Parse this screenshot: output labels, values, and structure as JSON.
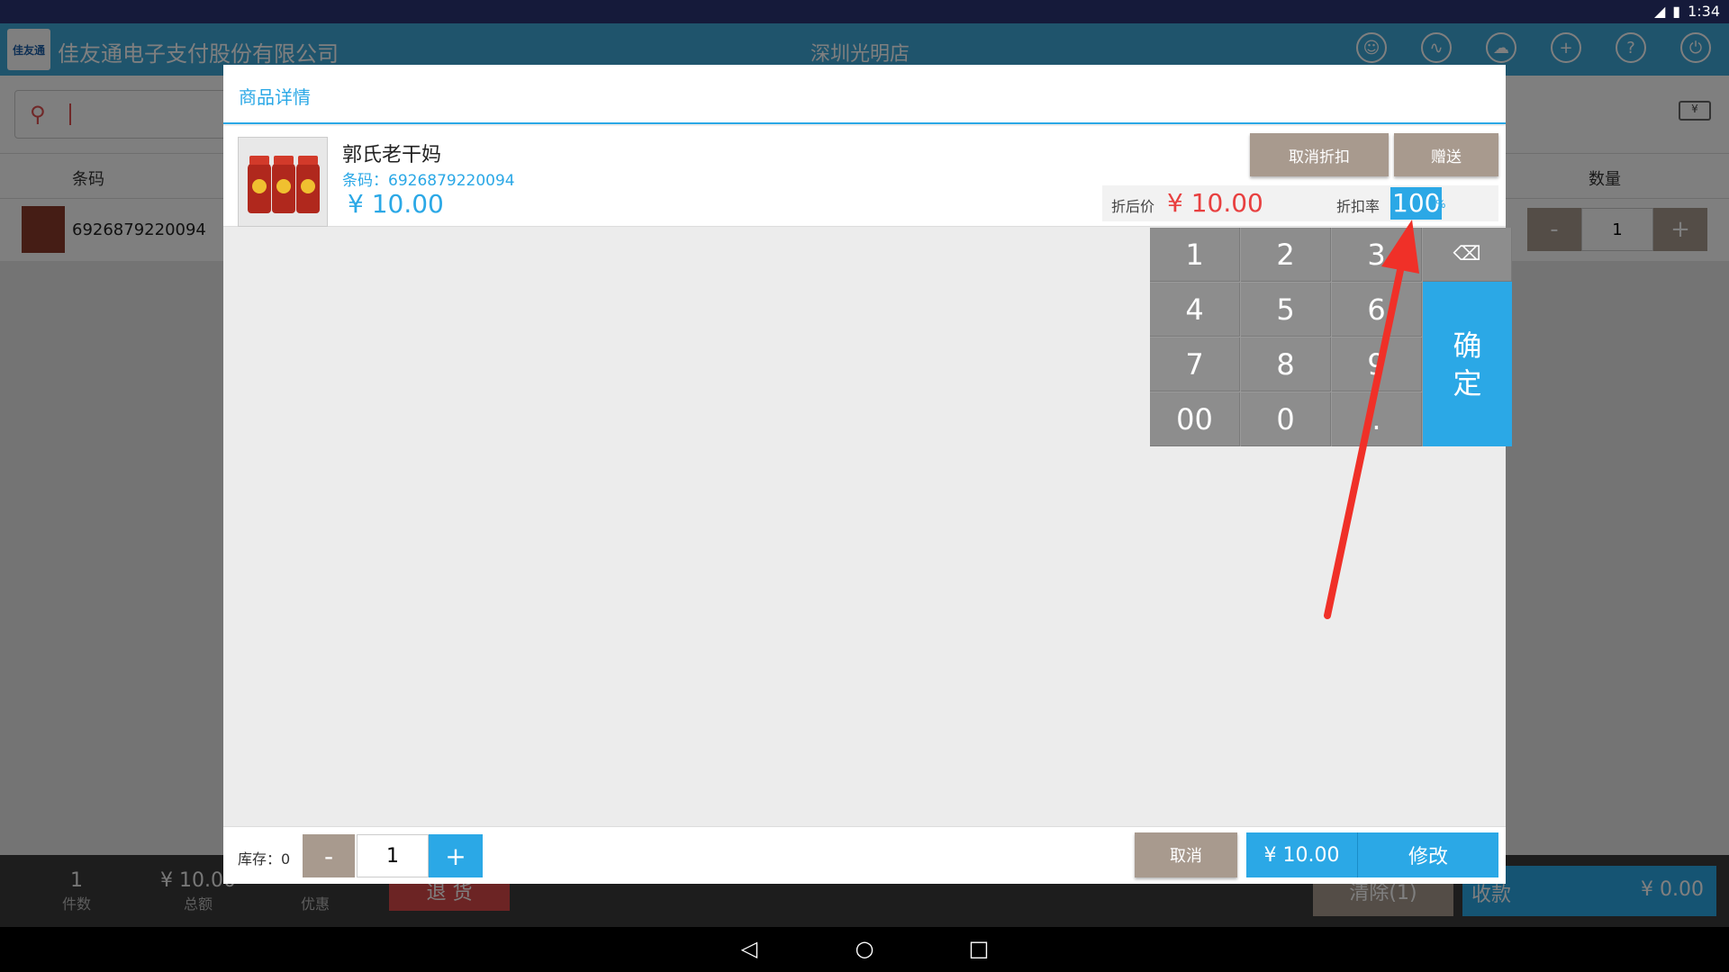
{
  "status": {
    "time": "1:34"
  },
  "app": {
    "company": "佳友通电子支付股份有限公司",
    "store": "深圳光明店",
    "logo_text": "佳友通"
  },
  "cart_table": {
    "col_barcode": "条码",
    "col_qty": "数量",
    "rows": [
      {
        "barcode": "6926879220094",
        "qty": "1"
      }
    ],
    "minus": "-",
    "plus": "+"
  },
  "bottom": {
    "count_value": "1",
    "count_label": "件数",
    "total_value": "¥ 10.00",
    "total_label": "总额",
    "discount_label": "优惠",
    "return_label": "退 货",
    "clear_label": "清除(1)",
    "pay_label": "收款",
    "pay_amount": "¥ 0.00"
  },
  "dialog": {
    "title": "商品详情",
    "product": {
      "name": "郭氏老干妈",
      "barcode": "条码：6926879220094",
      "price": "¥ 10.00"
    },
    "cancel_discount": "取消折扣",
    "gift": "赠送",
    "discounted_price_label": "折后价",
    "discounted_price": "¥ 10.00",
    "discount_rate_label": "折扣率",
    "discount_rate": "100",
    "percent": "%",
    "keypad": {
      "k1": "1",
      "k2": "2",
      "k3": "3",
      "k4": "4",
      "k5": "5",
      "k6": "6",
      "k7": "7",
      "k8": "8",
      "k9": "9",
      "k00": "00",
      "k0": "0",
      "kdot": ".",
      "ok": "确定"
    },
    "stock_label": "库存：0",
    "qty": "1",
    "minus": "-",
    "plus": "+",
    "cancel": "取消",
    "confirm_price": "¥ 10.00",
    "modify": "修改"
  },
  "colors": {
    "accent": "#2ba8e6",
    "danger": "#e84040",
    "neutral_button": "#a89a8e",
    "annotation_arrow": "#f03028"
  }
}
